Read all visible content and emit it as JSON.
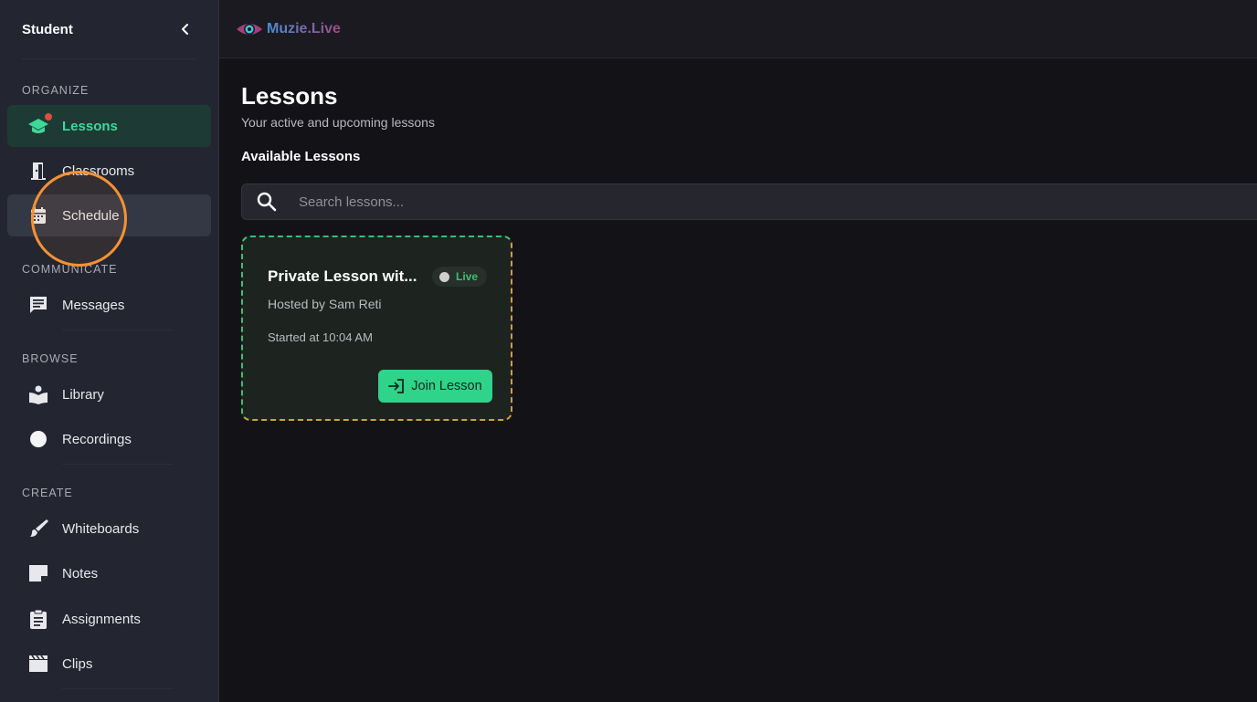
{
  "sidebar": {
    "title": "Student",
    "sections": {
      "organize": "ORGANIZE",
      "communicate": "COMMUNICATE",
      "browse": "BROWSE",
      "create": "CREATE"
    },
    "items": {
      "lessons": "Lessons",
      "classrooms": "Classrooms",
      "schedule": "Schedule",
      "messages": "Messages",
      "library": "Library",
      "recordings": "Recordings",
      "whiteboards": "Whiteboards",
      "notes": "Notes",
      "assignments": "Assignments",
      "clips": "Clips"
    }
  },
  "topbar": {
    "brand": "Muzie.Live"
  },
  "main": {
    "title": "Lessons",
    "subtitle": "Your active and upcoming lessons",
    "section_title": "Available Lessons",
    "search": {
      "placeholder": "Search lessons..."
    },
    "card": {
      "title": "Private Lesson wit...",
      "badge": "Live",
      "host": "Hosted by Sam Reti",
      "started": "Started at 10:04 AM",
      "join_label": "Join Lesson"
    }
  },
  "colors": {
    "accent": "#2fd38a",
    "active_text": "#3fd79a",
    "notification": "#e24b3b",
    "cursor_highlight": "#f39233"
  }
}
